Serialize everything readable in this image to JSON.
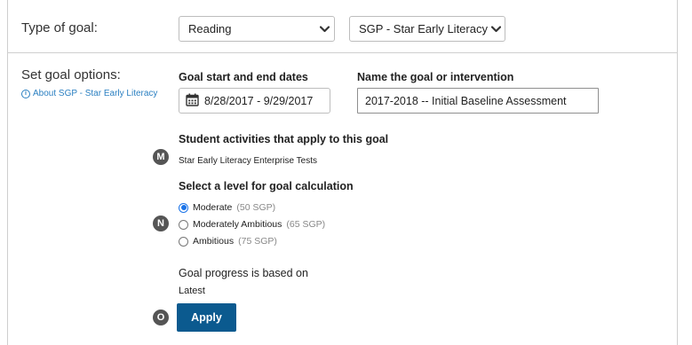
{
  "goal_type": {
    "label": "Type of goal:",
    "subject_value": "Reading",
    "assessment_value": "SGP - Star Early Literacy"
  },
  "goal_options": {
    "label": "Set goal options:",
    "about_link": "About SGP - Star Early Literacy",
    "dates_title": "Goal start and end dates",
    "dates_value": "8/28/2017 - 9/29/2017",
    "name_title": "Name the goal or intervention",
    "name_value": "2017-2018 -- Initial Baseline Assessment",
    "activities_title": "Student activities that apply to this goal",
    "activities_value": "Star Early Literacy Enterprise Tests",
    "level_title": "Select a level for goal calculation",
    "levels": [
      {
        "label": "Moderate",
        "sub": "(50 SGP)",
        "checked": true
      },
      {
        "label": "Moderately Ambitious",
        "sub": "(65 SGP)",
        "checked": false
      },
      {
        "label": "Ambitious",
        "sub": "(75 SGP)",
        "checked": false
      }
    ],
    "progress_title": "Goal progress is based on",
    "progress_value": "Latest",
    "apply_label": "Apply"
  },
  "badges": {
    "m": "M",
    "n": "N",
    "o": "O"
  },
  "colors": {
    "accent": "#0b5a8f",
    "link": "#2a7fc1",
    "badge": "#555555"
  }
}
